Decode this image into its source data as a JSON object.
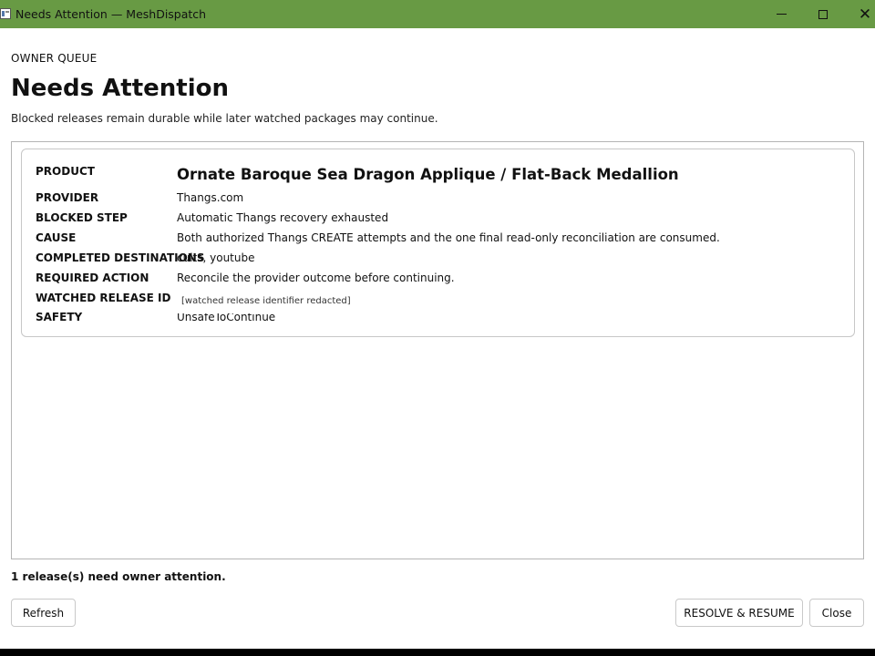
{
  "window": {
    "title": "Needs Attention — MeshDispatch",
    "controls": {
      "minimize": "",
      "maximize": "",
      "close": "✕"
    }
  },
  "header": {
    "overline": "OWNER QUEUE",
    "title": "Needs Attention",
    "subtitle": "Blocked releases remain durable while later watched packages may continue."
  },
  "release": {
    "product": {
      "label": "PRODUCT",
      "value": "Ornate Baroque Sea Dragon Applique / Flat-Back Medallion"
    },
    "provider": {
      "label": "PROVIDER",
      "value": "Thangs.com"
    },
    "blocked_step": {
      "label": "BLOCKED STEP",
      "value": "Automatic Thangs recovery exhausted"
    },
    "cause": {
      "label": "CAUSE",
      "value": "Both authorized Thangs CREATE attempts and the one final read-only reconciliation are consumed."
    },
    "completed_destinations": {
      "label": "COMPLETED DESTINATIONS",
      "value": "cults, youtube"
    },
    "required_action": {
      "label": "REQUIRED ACTION",
      "value": "Reconcile the provider outcome before continuing."
    },
    "watched_release_id": {
      "label": "WATCHED RELEASE ID",
      "value": "[watched release identifier redacted]"
    },
    "safety": {
      "label": "SAFETY",
      "value": "UnsafeToContinue"
    }
  },
  "footer": {
    "status": "1 release(s) need owner attention.",
    "refresh_label": "Refresh",
    "resolve_label": "RESOLVE & RESUME",
    "close_label": "Close"
  }
}
